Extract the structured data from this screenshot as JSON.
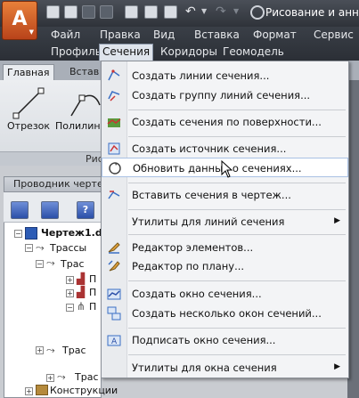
{
  "titlebar": {
    "title": "Рисование и аннот"
  },
  "menubar": {
    "row1": [
      "Файл",
      "Правка",
      "Вид",
      "Вставка",
      "Формат",
      "Сервис"
    ],
    "row2": [
      "Профиль",
      "Сечения",
      "Коридоры",
      "Геомодель"
    ],
    "active": "Сечения"
  },
  "ribbon": {
    "tabs": [
      "Главная",
      "Встав"
    ],
    "tools": [
      "Отрезок",
      "Полилин"
    ],
    "panel_title": "Рис"
  },
  "palette": {
    "title": "Проводник черте",
    "tree": [
      {
        "label": "Чертеж1.d",
        "bold": true
      },
      {
        "label": "Трассы"
      },
      {
        "label": "Трас"
      },
      {
        "label": "П"
      },
      {
        "label": "П"
      },
      {
        "label": "П"
      },
      {
        "label": "Трас"
      },
      {
        "label": "Трас"
      },
      {
        "label": "Конструкции"
      }
    ]
  },
  "menu": {
    "items": [
      {
        "label": "Создать линии сечения...",
        "icon": "section-lines-icon"
      },
      {
        "label": "Создать группу линий сечения...",
        "icon": "section-group-icon"
      },
      {
        "label": "Создать сечения по поверхности...",
        "icon": "surface-section-icon"
      },
      {
        "label": "Создать источник сечения...",
        "icon": "section-source-icon"
      },
      {
        "label": "Обновить данные о сечениях...",
        "icon": "refresh-section-icon"
      },
      {
        "label": "Вставить сечения в чертеж...",
        "icon": "insert-section-icon"
      },
      {
        "label": "Утилиты для линий сечения",
        "icon": "none"
      },
      {
        "label": "Редактор элементов...",
        "icon": "element-editor-icon"
      },
      {
        "label": "Редактор по плану...",
        "icon": "plan-editor-icon"
      },
      {
        "label": "Создать окно сечения...",
        "icon": "section-view-icon"
      },
      {
        "label": "Создать несколько окон сечений...",
        "icon": "multi-section-view-icon"
      },
      {
        "label": "Подписать окно сечения...",
        "icon": "label-section-view-icon"
      },
      {
        "label": "Утилиты для окна сечения",
        "icon": "none"
      }
    ],
    "highlighted": "Обновить данные о сечениях..."
  },
  "colors": {
    "accent": "#a9c1e4",
    "app_button": "#d8642a",
    "menubar": "#2f333a"
  }
}
